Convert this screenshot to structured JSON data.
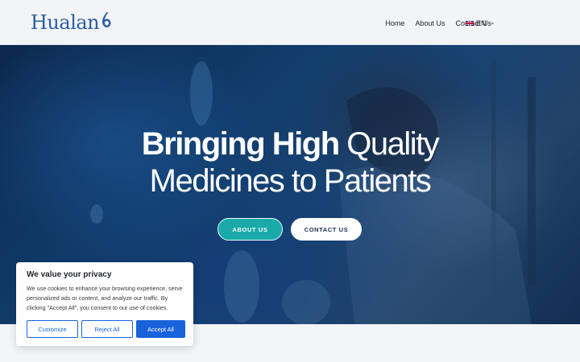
{
  "header": {
    "logo_text": "Hualan",
    "nav": [
      "Home",
      "About Us",
      "Contact Us"
    ],
    "language": "EN"
  },
  "hero": {
    "title_bold": "Bringing High",
    "title_light_1": "Quality",
    "title_light_2": "Medicines to Patients",
    "about_button": "ABOUT US",
    "contact_button": "CONTACT US"
  },
  "cookie": {
    "title": "We value your privacy",
    "text": "We use cookies to enhance your browsing experience, serve personalized ads or content, and analyze our traffic. By clicking \"Accept All\", you consent to our use of cookies.",
    "customize": "Customize",
    "reject": "Reject All",
    "accept": "Accept All"
  },
  "colors": {
    "brand_blue": "#2a5ea8",
    "teal": "#19a9a9",
    "cookie_blue": "#1863dc"
  }
}
